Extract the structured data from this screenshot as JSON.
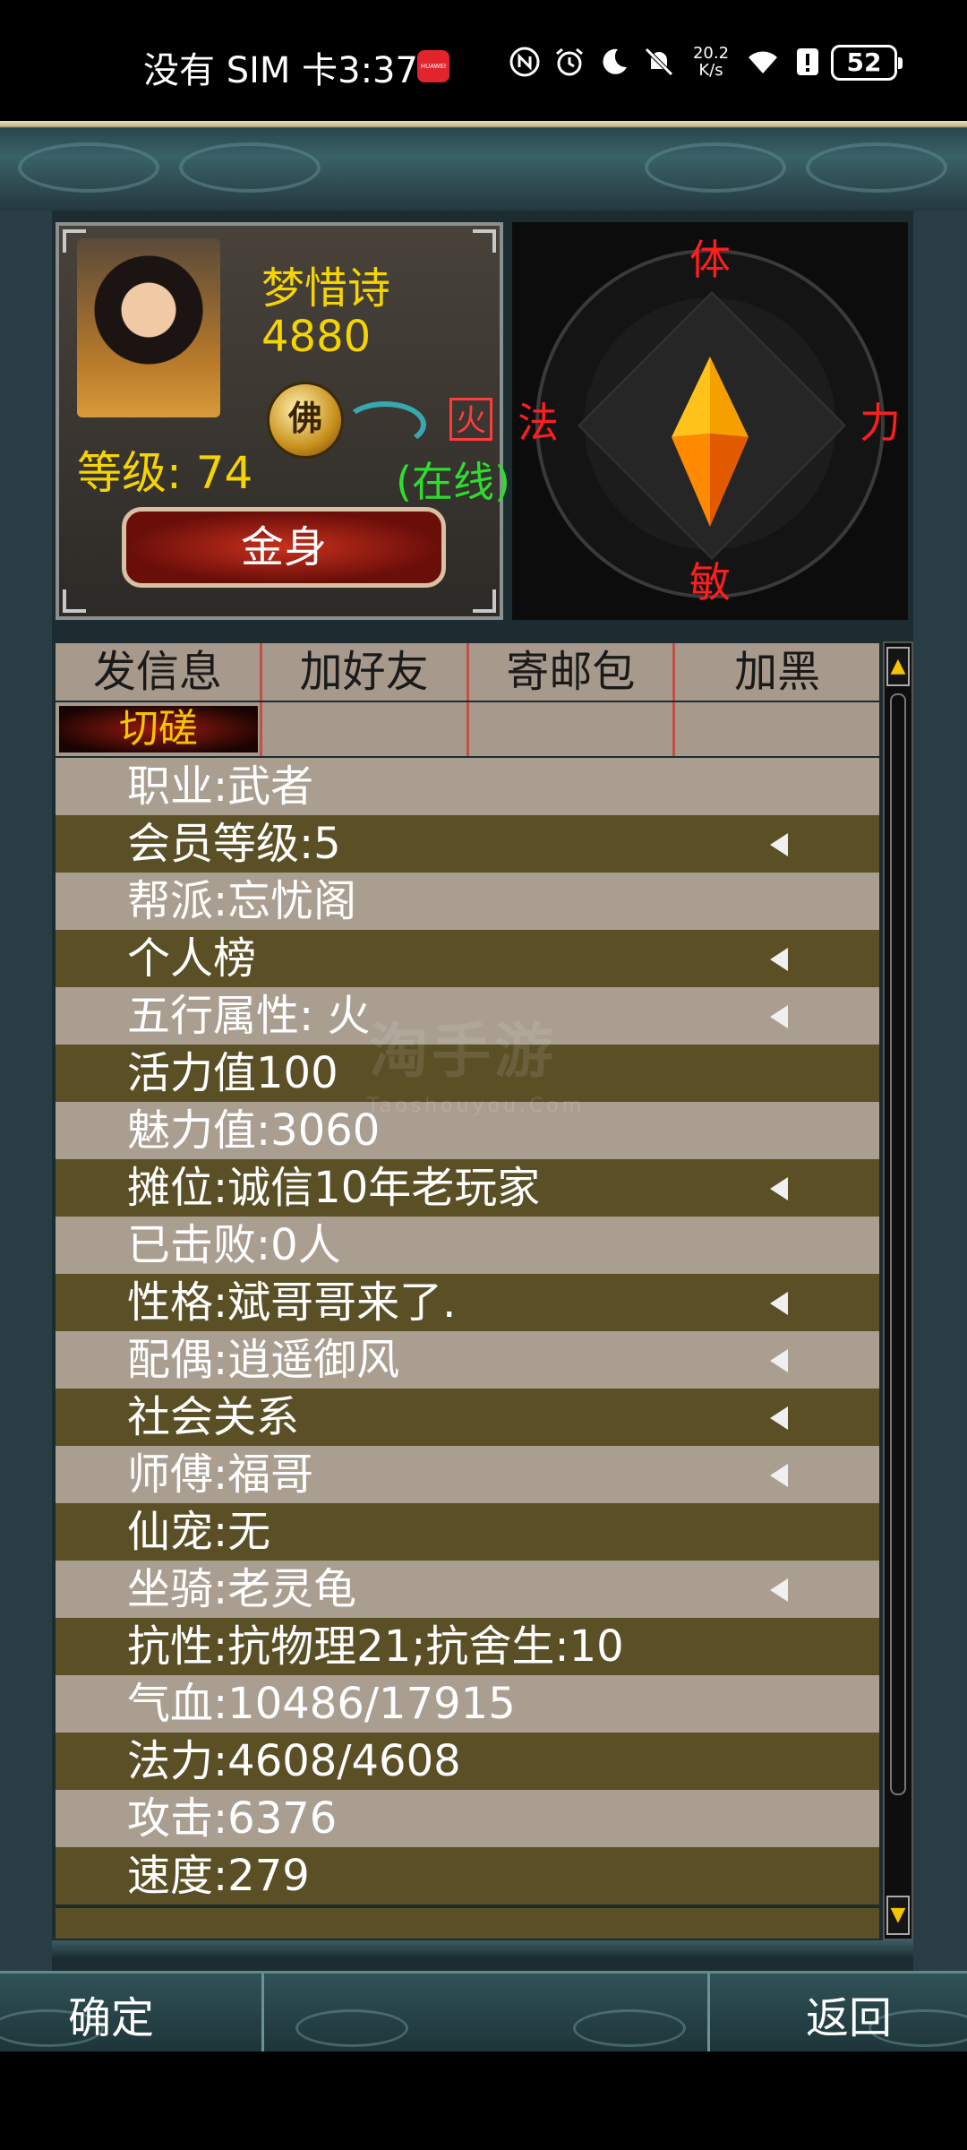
{
  "status_bar": {
    "carrier_time": "没有 SIM 卡3:37",
    "app_badge": "HUAWEI",
    "net_speed_value": "20.2",
    "net_speed_unit": "K/s",
    "battery": "52",
    "icons": [
      "nfc-icon",
      "alarm-icon",
      "moon-icon",
      "mute-icon",
      "wifi-icon",
      "alert-icon"
    ]
  },
  "profile": {
    "name": "梦惜诗",
    "score": "4880",
    "badge": "佛",
    "element_icon": "火",
    "level": "等级: 74",
    "online": "(在线)",
    "golden_body_button": "金身"
  },
  "compass": {
    "top": "体",
    "left": "法",
    "right": "力",
    "bottom": "敏",
    "colors": {
      "label": "#ff1e1e",
      "gem_light": "#ffc21a",
      "gem_dark": "#e25a00"
    }
  },
  "actions": {
    "send_message": "发信息",
    "add_friend": "加好友",
    "mail_package": "寄邮包",
    "blacklist": "加黑",
    "spar": "切磋"
  },
  "info_rows": [
    {
      "text": "职业:武者",
      "arrow": false
    },
    {
      "text": "会员等级:5",
      "arrow": true
    },
    {
      "text": "帮派:忘忧阁",
      "arrow": false
    },
    {
      "text": "个人榜",
      "arrow": true
    },
    {
      "text": "五行属性:  火",
      "arrow": true
    },
    {
      "text": "活力值100",
      "arrow": false
    },
    {
      "text": "魅力值:3060",
      "arrow": false
    },
    {
      "text": "摊位:诚信10年老玩家",
      "arrow": true
    },
    {
      "text": "已击败:0人",
      "arrow": false
    },
    {
      "text": "性格:斌哥哥来了.",
      "arrow": true
    },
    {
      "text": "配偶:逍遥御风",
      "arrow": true
    },
    {
      "text": "社会关系",
      "arrow": true
    },
    {
      "text": "师傅:福哥",
      "arrow": true
    },
    {
      "text": "仙宠:无",
      "arrow": false
    },
    {
      "text": "坐骑:老灵龟",
      "arrow": true
    },
    {
      "text": "抗性:抗物理21;抗舍生:10",
      "arrow": false
    },
    {
      "text": "气血:10486/17915",
      "arrow": false
    },
    {
      "text": "法力:4608/4608",
      "arrow": false
    },
    {
      "text": "攻击:6376",
      "arrow": false
    },
    {
      "text": "速度:279",
      "arrow": false
    }
  ],
  "watermark": {
    "main": "淘手游",
    "sub": "Taoshouyou.Com"
  },
  "bottom": {
    "confirm": "确定",
    "back": "返回"
  }
}
